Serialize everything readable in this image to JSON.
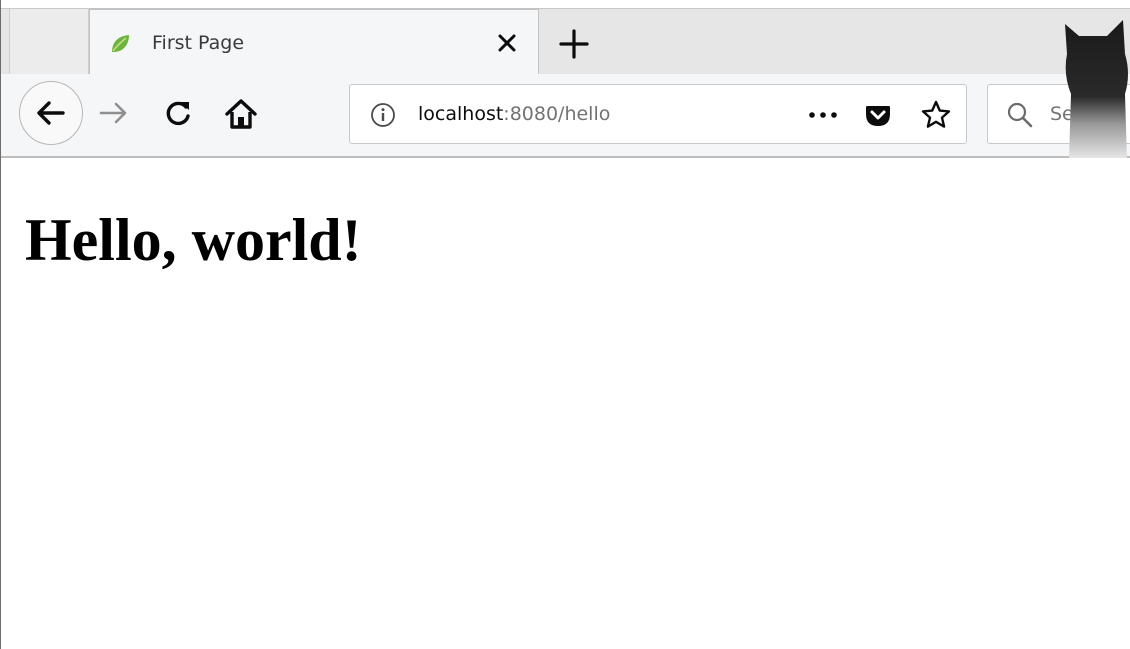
{
  "tab": {
    "title": "First Page",
    "favicon": "spring-leaf-icon",
    "favicon_color": "#6db33f"
  },
  "address_bar": {
    "host": "localhost",
    "rest": ":8080/hello"
  },
  "search": {
    "placeholder": "Search"
  },
  "page": {
    "heading": "Hello, world!"
  },
  "icons": {
    "back": "arrow-left-icon",
    "forward": "arrow-right-icon",
    "reload": "reload-icon",
    "home": "home-icon",
    "info": "info-icon",
    "more": "page-actions-icon",
    "pocket": "pocket-icon",
    "bookmark": "star-icon",
    "search": "search-icon",
    "close_tab": "close-icon",
    "new_tab": "plus-icon"
  },
  "colors": {
    "toolbar_bg": "#f5f6f7",
    "tabstrip_bg": "#e6e6e6",
    "url_host": "#0c0c0d",
    "url_rest": "#737373"
  }
}
